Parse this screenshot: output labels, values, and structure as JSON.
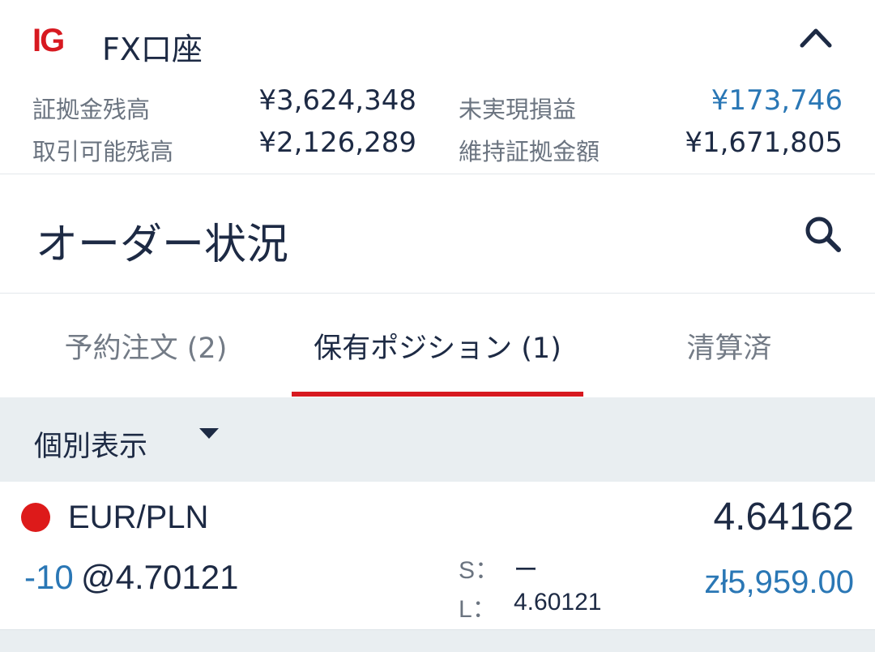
{
  "header": {
    "logo": "IG",
    "title": "FX口座",
    "summary": [
      {
        "label": "証拠金残高",
        "value": "¥3,624,348"
      },
      {
        "label": "未実現損益",
        "value": "¥173,746",
        "color": "#2a77b5"
      },
      {
        "label": "取引可能残高",
        "value": "¥2,126,289"
      },
      {
        "label": "維持証拠金額",
        "value": "¥1,671,805"
      }
    ],
    "collapse_icon": "chevron-up-icon"
  },
  "page": {
    "title": "オーダー状況",
    "search_icon": "search-icon"
  },
  "tabs": [
    {
      "label": "予約注文 (2)",
      "active": false
    },
    {
      "label": "保有ポジション (1)",
      "active": true
    },
    {
      "label": "清算済",
      "active": false
    }
  ],
  "filter": {
    "label": "個別表示",
    "caret_icon": "caret-down-icon"
  },
  "position": {
    "status_color": "#dd1a1a",
    "instrument": "EUR/PLN",
    "current_price": "4.64162",
    "size": "-10",
    "open_price": "@4.70121",
    "stop_label": "S：",
    "stop_value": "ー",
    "limit_label": "L：",
    "limit_value": "4.60121",
    "pnl": "zł5,959.00"
  },
  "colors": {
    "brand": "#d71920",
    "accent_blue": "#2a77b5",
    "text_dark": "#1d2a44",
    "text_muted": "#6b7480"
  }
}
